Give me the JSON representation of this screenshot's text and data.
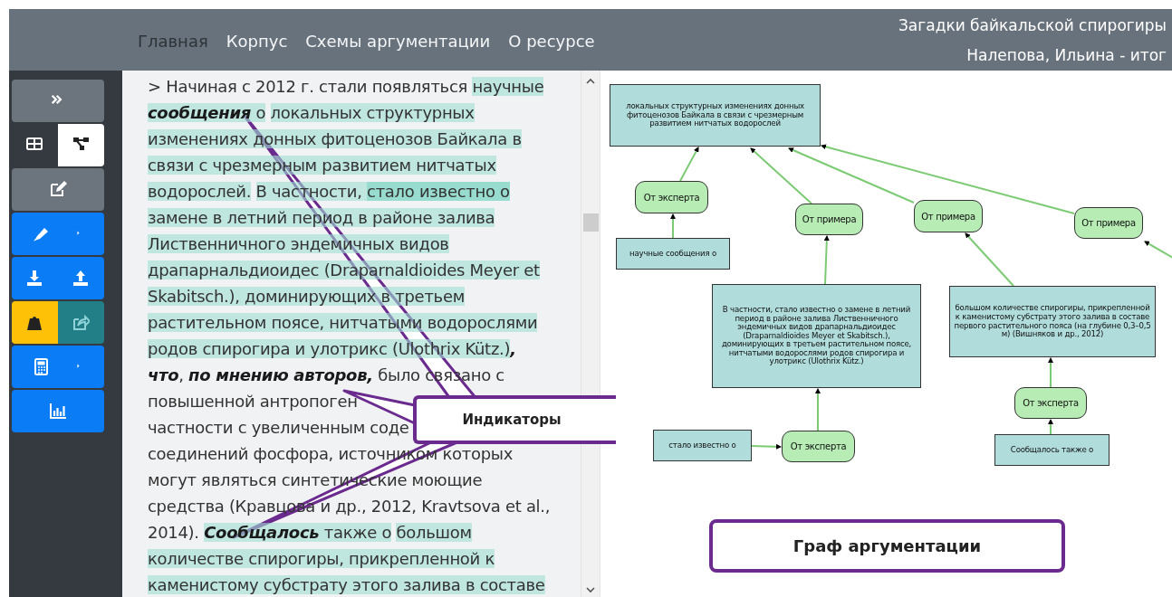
{
  "nav": [
    {
      "label": "Главная",
      "selected": true
    },
    {
      "label": "Корпус",
      "selected": false
    },
    {
      "label": "Схемы аргументации",
      "selected": false
    },
    {
      "label": "О ресурсе",
      "selected": false
    }
  ],
  "header_info": [
    "Загадки байкальской спирогиры",
    "Налепова, Ильина - итог"
  ],
  "sidebar": {
    "view_toggle": [
      {
        "kind": "table",
        "selected": false
      },
      {
        "kind": "graph",
        "selected": true
      }
    ]
  },
  "text_lines": [
    [
      {
        "text": "> Начиная с 2012 г. стали появляться ",
        "highlighted": false
      },
      {
        "text": "научные",
        "highlighted": true
      }
    ],
    [
      {
        "text": "сообщения",
        "highlighted": true,
        "emphasis": true
      },
      {
        "text": " о",
        "highlighted": true
      },
      {
        "text": "локальных структурных",
        "highlighted": true,
        "gap_before": true
      }
    ],
    [
      {
        "text": "изменениях донных фитоценозов Байкала в",
        "highlighted": true
      }
    ],
    [
      {
        "text": "связи с чрезмерным развитием нитчатых",
        "highlighted": true
      }
    ],
    [
      {
        "text": "водорослей.",
        "highlighted": true
      },
      {
        "text": "В частности, ",
        "highlighted": true,
        "gap_before": true
      },
      {
        "text": "стало известно о",
        "highlighted": true,
        "focused": true
      }
    ],
    [
      {
        "text": "замене в летний период в районе залива",
        "highlighted": true
      }
    ],
    [
      {
        "text": "Лиственничного эндемичных видов",
        "highlighted": true
      }
    ],
    [
      {
        "text": "драпарнальдиоидес (Draparnaldioides Meyer et",
        "highlighted": true
      }
    ],
    [
      {
        "text": "Skabitsch.), доминирующих в третьем",
        "highlighted": true
      }
    ],
    [
      {
        "text": "растительном поясе, нитчатыми водорослями",
        "highlighted": true
      }
    ],
    [
      {
        "text": "родов спирогира и улотрикс (Ulothrix Kütz.)",
        "highlighted": true
      },
      {
        "text": ",",
        "highlighted": false,
        "emphasis": true
      }
    ],
    [
      {
        "text": "что",
        "highlighted": false,
        "emphasis": true
      },
      {
        "text": ", ",
        "highlighted": false
      },
      {
        "text": "по мнению авторов,",
        "highlighted": false,
        "emphasis": true
      },
      {
        "text": " было связано с",
        "highlighted": false
      }
    ],
    [
      {
        "text": "повышенной антропоген",
        "highlighted": false
      }
    ],
    [
      {
        "text": "частности с увеличенным соде",
        "highlighted": false
      }
    ],
    [
      {
        "text": "соединений фосфора, источником которых",
        "highlighted": false
      }
    ],
    [
      {
        "text": "могут являться синтетические моющие",
        "highlighted": false
      }
    ],
    [
      {
        "text": "средства (Кравцова и др., 2012, Kravtsova et al.,",
        "highlighted": false
      }
    ],
    [
      {
        "text": "2014). ",
        "highlighted": false
      },
      {
        "text": "Сообщалось",
        "highlighted": true,
        "emphasis": true
      },
      {
        "text": " также о",
        "highlighted": true
      },
      {
        "text": "большом",
        "highlighted": true,
        "gap_before": true
      }
    ],
    [
      {
        "text": "количестве спирогиры, прикрепленной к",
        "highlighted": true
      }
    ],
    [
      {
        "text": "каменистому субстрату этого залива в составе",
        "highlighted": true
      }
    ]
  ],
  "graph": {
    "kind": "statement",
    "text": "локальных структурных изменениях донных фитоценозов Байкала в связи с чрезмерным развитием нитчатых водорослей",
    "children": [
      {
        "kind": "scheme",
        "text": "От эксперта",
        "children": [
          {
            "kind": "statement",
            "text": "научные сообщения о"
          }
        ]
      },
      {
        "kind": "scheme",
        "text": "От примера",
        "children": [
          {
            "kind": "statement",
            "text": "В частности, стало известно о замене в летний период в районе залива Лиственничного эндемичных видов драпарнальдиоидес (Draparnaldioides Meyer et Skabitsch.), доминирующих в третьем растительном поясе, нитчатыми водорослями родов спирогира и улотрикс (Ulothrix Kütz.)",
            "children": [
              {
                "kind": "scheme",
                "text": "От эксперта",
                "children": [
                  {
                    "kind": "statement",
                    "text": "стало известно о"
                  }
                ]
              }
            ]
          }
        ]
      },
      {
        "kind": "scheme",
        "text": "От примера",
        "children": [
          {
            "kind": "statement",
            "text": "большом количестве спирогиры, прикрепленной к каменистому субстрату этого залива в составе первого растительного пояса (на глубине 0,3–0,5 м) (Вишняков и др., 2012)",
            "children": [
              {
                "kind": "scheme",
                "text": "От эксперта",
                "children": [
                  {
                    "kind": "statement",
                    "text": "Сообщалось также о"
                  }
                ]
              }
            ]
          }
        ]
      },
      {
        "kind": "scheme",
        "text": "От примера"
      }
    ]
  },
  "callouts": [
    {
      "label": "Индикаторы"
    },
    {
      "label": "Граф аргументации"
    }
  ]
}
